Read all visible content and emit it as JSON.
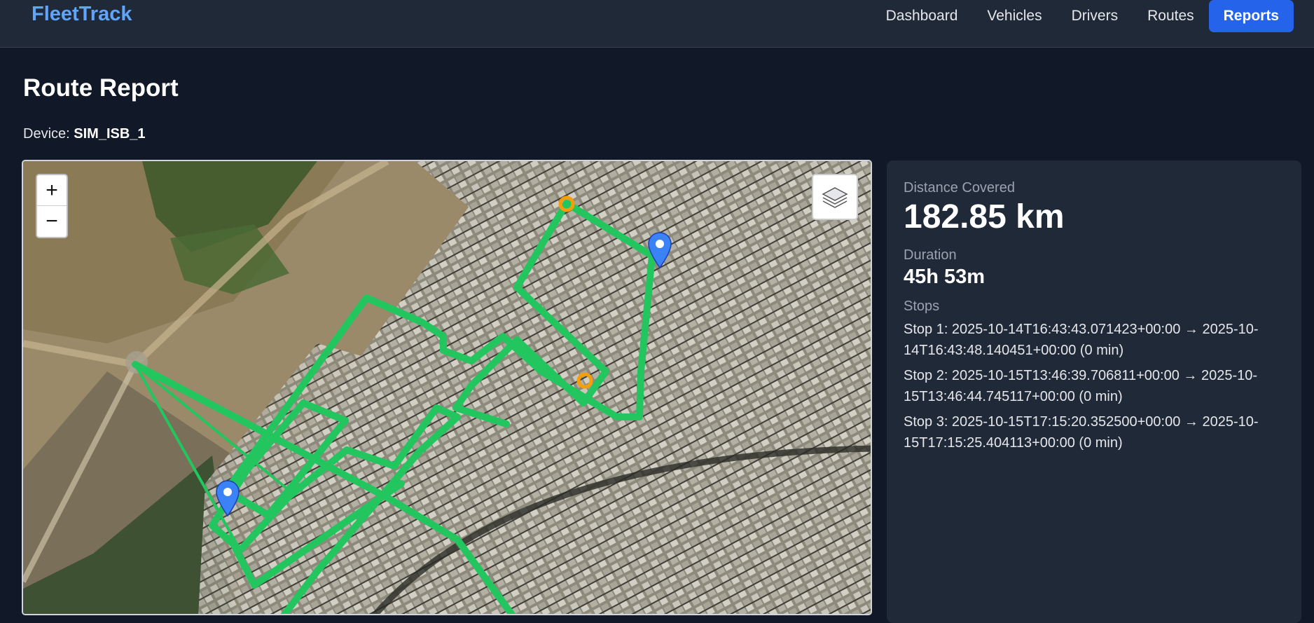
{
  "app": {
    "brand": "FleetTrack"
  },
  "nav": {
    "items": [
      {
        "label": "Dashboard"
      },
      {
        "label": "Vehicles"
      },
      {
        "label": "Drivers"
      },
      {
        "label": "Routes"
      },
      {
        "label": "Reports",
        "active": true
      }
    ]
  },
  "page": {
    "title": "Route Report",
    "device_label": "Device:",
    "device_value": "SIM_ISB_1"
  },
  "map": {
    "zoom_in": "+",
    "zoom_out": "−",
    "layers_icon": "layers-icon",
    "route_color": "#22c55e",
    "stop_marker_color": "#f59e0b",
    "pin_color": "#3b82f6"
  },
  "stats": {
    "distance_label": "Distance Covered",
    "distance_value": "182.85 km",
    "duration_label": "Duration",
    "duration_value": "45h 53m",
    "stops_label": "Stops",
    "stops": [
      "Stop 1: 2025-10-14T16:43:43.071423+00:00 → 2025-10-14T16:43:48.140451+00:00 (0 min)",
      "Stop 2: 2025-10-15T13:46:39.706811+00:00 → 2025-10-15T13:46:44.745117+00:00 (0 min)",
      "Stop 3: 2025-10-15T17:15:20.352500+00:00 → 2025-10-15T17:15:25.404113+00:00 (0 min)"
    ]
  }
}
